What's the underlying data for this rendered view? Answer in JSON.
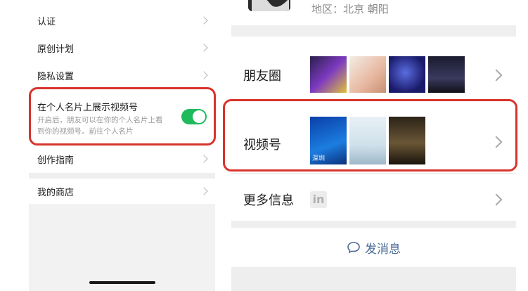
{
  "left_panel": {
    "items": [
      {
        "label": "认证"
      },
      {
        "label": "原创计划"
      },
      {
        "label": "隐私设置"
      }
    ],
    "toggle_setting": {
      "title": "在个人名片上展示视频号",
      "description_line1": "开启后，朋友可以在你的个人名片上看",
      "description_line2": "到你的视频号。前往个人名片",
      "enabled": true
    },
    "guide": {
      "label": "创作指南"
    },
    "shop": {
      "label": "我的商店"
    }
  },
  "right_panel": {
    "region": "地区：北京 朝阳",
    "moments": {
      "label": "朋友圈"
    },
    "channels": {
      "label": "视频号",
      "thumb1_caption": "深圳"
    },
    "more_info": {
      "label": "更多信息",
      "badge": "in"
    },
    "send_message": {
      "label": "发消息"
    }
  },
  "colors": {
    "accent_green": "#1fba5b",
    "highlight_red": "#d8332c"
  }
}
